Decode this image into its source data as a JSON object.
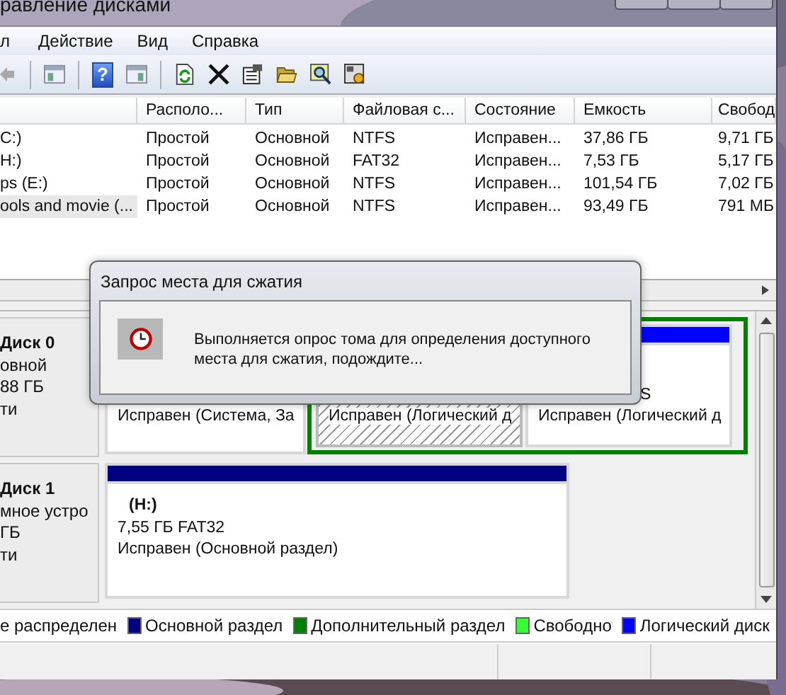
{
  "window": {
    "title": "равление дисками"
  },
  "menu": [
    {
      "label": "л"
    },
    {
      "label": "Действие"
    },
    {
      "label": "Вид"
    },
    {
      "label": "Справка"
    }
  ],
  "toolbar": [
    {
      "kind": "back",
      "disabled": true
    },
    {
      "kind": "separator"
    },
    {
      "kind": "panel-left"
    },
    {
      "kind": "separator"
    },
    {
      "kind": "help",
      "glyph": "?"
    },
    {
      "kind": "panel-right"
    },
    {
      "kind": "separator"
    },
    {
      "kind": "refresh"
    },
    {
      "kind": "delete"
    },
    {
      "kind": "properties"
    },
    {
      "kind": "open"
    },
    {
      "kind": "search"
    },
    {
      "kind": "settings"
    }
  ],
  "volumes": {
    "columns": [
      "",
      "Располо...",
      "Тип",
      "Файловая с...",
      "Состояние",
      "Емкость",
      "Свобод"
    ],
    "rows": [
      {
        "cells": [
          "C:)",
          "Простой",
          "Основной",
          "NTFS",
          "Исправен...",
          "37,86 ГБ",
          "9,71 ГБ"
        ],
        "selected": false
      },
      {
        "cells": [
          "H:)",
          "Простой",
          "Основной",
          "FAT32",
          "Исправен...",
          "7,53 ГБ",
          "5,17 ГБ"
        ],
        "selected": false
      },
      {
        "cells": [
          "ps (E:)",
          "Простой",
          "Основной",
          "NTFS",
          "Исправен...",
          "101,54 ГБ",
          "7,02 ГБ"
        ],
        "selected": false
      },
      {
        "cells": [
          "ools and movie (...",
          "Простой",
          "Основной",
          "NTFS",
          "Исправен...",
          "93,49 ГБ",
          "791 МБ"
        ],
        "selected": true
      }
    ]
  },
  "disks": [
    {
      "name": "Диск 0",
      "lines": [
        "овной",
        "88 ГБ",
        "ти"
      ],
      "parts": [
        {
          "kind": "partition",
          "status": "Исправен (Система, За",
          "selected": false
        },
        {
          "kind": "extended",
          "color": "#008000",
          "parts": [
            {
              "kind": "partition",
              "status": "Исправен (Логический д",
              "selected": true
            },
            {
              "kind": "partition",
              "color": "#0000ff",
              "size": "S",
              "status": "Исправен (Логический д",
              "selected": false
            }
          ]
        }
      ]
    },
    {
      "name": "Диск 1",
      "lines": [
        "мное устро",
        "ГБ",
        "ти"
      ],
      "parts": [
        {
          "kind": "partition",
          "color": "#000080",
          "title": "(H:)",
          "size": "7,55 ГБ FAT32",
          "status": "Исправен (Основной раздел)",
          "selected": false
        }
      ]
    }
  ],
  "legend": [
    {
      "label": "е распределен"
    },
    {
      "label": "Основной раздел",
      "color": "#000080"
    },
    {
      "label": "Дополнительный раздел",
      "color": "#008000"
    },
    {
      "label": "Свободно",
      "color": "#33ff33"
    },
    {
      "label": "Логический диск",
      "color": "#0000ff"
    }
  ],
  "dialog": {
    "title": "Запрос места для сжатия",
    "message": "Выполняется опрос тома для определения доступного места для сжатия, подождите..."
  }
}
